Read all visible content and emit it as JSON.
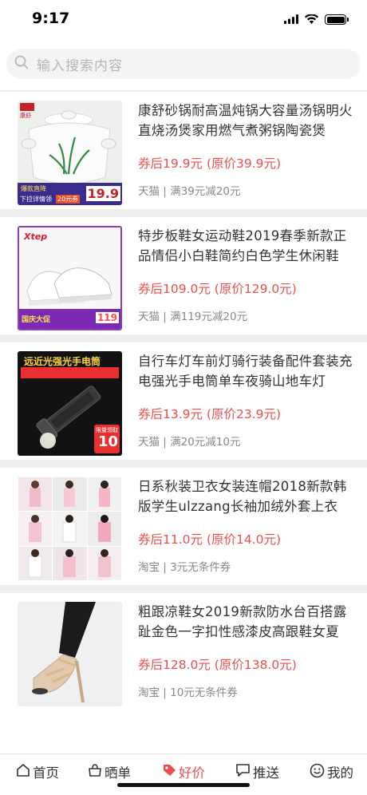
{
  "status_bar": {
    "time": "9:17"
  },
  "search": {
    "placeholder": "输入搜索内容"
  },
  "products": [
    {
      "title": "康舒砂锅耐高温炖锅大容量汤锅明火直烧汤煲家用燃气煮粥锅陶瓷煲",
      "price": "券后19.9元 (原价39.9元)",
      "meta": "天猫 | 满39元减20元",
      "image_texts": {
        "brand": "康舒",
        "promo": "爆款直降",
        "promo2": "下拉详情领",
        "coupon": "20元券",
        "price": "19.9"
      }
    },
    {
      "title": "特步板鞋女运动鞋2019春季新款正品情侣小白鞋简约白色学生休闲鞋",
      "price": "券后109.0元 (原价129.0元)",
      "meta": "天猫 | 满119元减20元",
      "image_texts": {
        "brand": "Xtep",
        "promo": "国庆大促",
        "price": "119"
      }
    },
    {
      "title": "自行车灯车前灯骑行装备配件套装充电强光手电筒单车夜骑山地车灯",
      "price": "券后13.9元 (原价23.9元)",
      "meta": "天猫 | 满20元减10元",
      "image_texts": {
        "banner": "远近光强光手电筒",
        "tag": "限量领取",
        "coupon": "10"
      }
    },
    {
      "title": "日系秋装卫衣女装连帽2018新款韩版学生ulzzang长袖加绒外套上衣",
      "price": "券后11.0元 (原价14.0元)",
      "meta": "淘宝 | 3元无条件券"
    },
    {
      "title": "粗跟凉鞋女2019新款防水台百搭露趾金色一字扣性感漆皮高跟鞋女夏",
      "price": "券后128.0元 (原价138.0元)",
      "meta": "淘宝 | 10元无条件券"
    }
  ],
  "tabs": [
    {
      "label": "首页",
      "icon": "home-icon"
    },
    {
      "label": "晒单",
      "icon": "bag-icon"
    },
    {
      "label": "好价",
      "icon": "tag-icon",
      "active": true
    },
    {
      "label": "推送",
      "icon": "chat-icon"
    },
    {
      "label": "我的",
      "icon": "smiley-icon"
    }
  ],
  "colors": {
    "accent": "#e85050",
    "text": "#333333",
    "meta": "#888888",
    "separator": "#eeeeee"
  }
}
